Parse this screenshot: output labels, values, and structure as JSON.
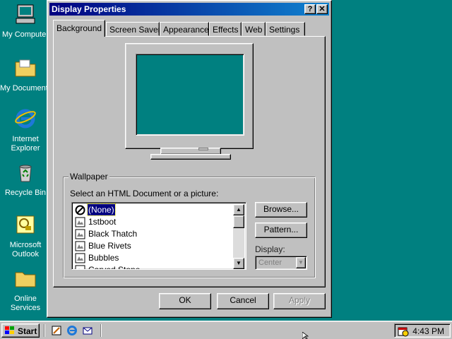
{
  "desktop": {
    "icons": [
      {
        "label": "My Computer",
        "icon": "my-computer-icon"
      },
      {
        "label": "My Documents",
        "icon": "folder-icon"
      },
      {
        "label": "Internet Explorer",
        "icon": "internet-explorer-icon"
      },
      {
        "label": "Recycle Bin",
        "icon": "recycle-bin-icon"
      },
      {
        "label": "Microsoft Outlook",
        "icon": "outlook-icon"
      },
      {
        "label": "Online Services",
        "icon": "folder-icon"
      }
    ]
  },
  "window": {
    "title": "Display Properties",
    "help_button": "?",
    "close_button": "✕",
    "tabs": [
      "Background",
      "Screen Saver",
      "Appearance",
      "Effects",
      "Web",
      "Settings"
    ],
    "active_tab": "Background"
  },
  "wallpaper": {
    "group_label": "Wallpaper",
    "prompt": "Select an HTML Document or a picture:",
    "items": [
      "(None)",
      "1stboot",
      "Black Thatch",
      "Blue Rivets",
      "Bubbles",
      "Carved Stone"
    ],
    "selected": "(None)",
    "browse_button": "Browse...",
    "pattern_button": "Pattern...",
    "display_label": "Display:",
    "display_value": "Center"
  },
  "dialog_buttons": {
    "ok": "OK",
    "cancel": "Cancel",
    "apply": "Apply"
  },
  "taskbar": {
    "start_label": "Start",
    "quick_launch": [
      "quick-launch-edit-icon",
      "internet-explorer-icon",
      "outlook-express-icon"
    ],
    "clock": "4:43 PM"
  },
  "colors": {
    "desktop": "#008080",
    "face": "#c0c0c0",
    "title_start": "#000080",
    "title_end": "#1084d0",
    "selection": "#000080"
  }
}
